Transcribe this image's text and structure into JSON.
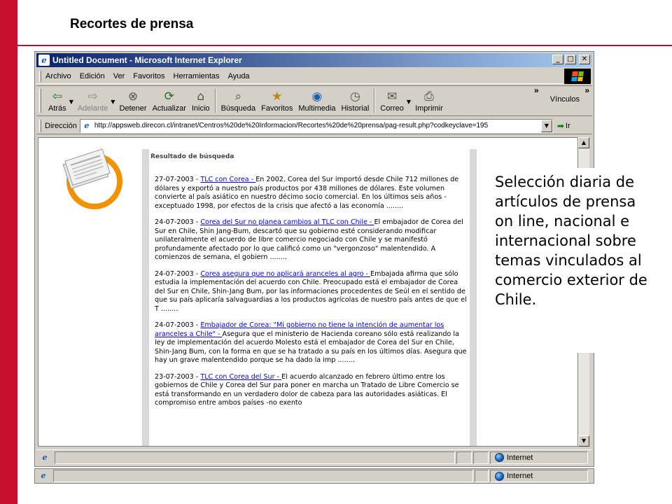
{
  "slide": {
    "title": "Recortes de prensa"
  },
  "window": {
    "title": "Untitled Document - Microsoft Internet Explorer",
    "controls": {
      "minimize": "_",
      "maximize": "□",
      "close": "✕"
    }
  },
  "menu": [
    "Archivo",
    "Edición",
    "Ver",
    "Favoritos",
    "Herramientas",
    "Ayuda"
  ],
  "toolbar": {
    "back": "Atrás",
    "forward": "Adelante",
    "stop": "Detener",
    "refresh": "Actualizar",
    "home": "Inicio",
    "search": "Búsqueda",
    "favorites": "Favoritos",
    "media": "Multimedia",
    "history": "Historial",
    "mail": "Correo",
    "print": "Imprimir",
    "links": "Vínculos"
  },
  "address": {
    "label": "Dirección",
    "url": "http://appsweb.direcon.cl/intranet/Centros%20de%20Informacion/Recortes%20de%20prensa/pag-result.php?codkeyclave=195",
    "go": "Ir"
  },
  "results": {
    "title": "Resultado de búsqueda",
    "items": [
      {
        "date": "27-07-2003 - ",
        "link": "TLC con Corea - ",
        "text": "En 2002, Corea del Sur importó desde Chile 712 millones de dólares y exportó a nuestro país productos por 438 millones de dólares. Este volumen convierte al país asiático en nuestro décimo socio comercial. En los últimos seis años - exceptuado 1998, por efectos de la crisis que afectó a las economía ........"
      },
      {
        "date": "24-07-2003 - ",
        "link": "Corea del Sur no planea cambios al TLC con Chile - ",
        "text": "El embajador de Corea del Sur en Chile, Shin Jang-Bum, descartó que su gobierno esté considerando modificar unilateralmente el acuerdo de libre comercio negociado con Chile y se manifestó profundamente afectado por lo que calificó como un \"vergonzoso\" malentendido. A comienzos de semana, el gobiern ........"
      },
      {
        "date": "24-07-2003 - ",
        "link": "Corea asegura que no aplicará aranceles al agro - ",
        "text": "Embajada afirma que sólo estudia la implementación del acuerdo con Chile. Preocupado está el embajador de Corea del Sur en Chile, Shin-Jang Bum, por las informaciones procedentes de Seúl en el sentido de que su país aplicaría salvaguardias a los productos agrícolas de nuestro país antes de que el T ........"
      },
      {
        "date": "24-07-2003 - ",
        "link": "Embajador de Corea: \"Mi gobierno no tiene la intención de aumentar los aranceles a Chile\" - ",
        "text": "Asegura que el ministerio de Hacienda coreano sólo está realizando la ley de implementación del acuerdo Molesto está el embajador de Corea del Sur en Chile, Shin-Jang Bum, con la forma en que se ha tratado a su país en los últimos días. Asegura que hay un grave malentendido porque se ha dado la imp ........"
      },
      {
        "date": "23-07-2003 - ",
        "link": "TLC con Corea del Sur - ",
        "text": "El acuerdo alcanzado en febrero último entre los gobiernos de Chile y Corea del Sur para poner en marcha un Tratado de Libre Comercio se está transformando en un verdadero dolor de cabeza para las autoridades asiáticas. El compromiso entre ambos países -no exento"
      }
    ]
  },
  "status": {
    "zone": "Internet"
  },
  "callout": "Selección diaria de artículos de prensa on line, nacional e internacional sobre temas vinculados al comercio exterior de Chile.",
  "colors": {
    "accent": "#c8102e",
    "ie_title_start": "#0a246a",
    "link": "#0000ee",
    "logo_orange": "#f39200"
  },
  "icons": [
    "back-arrow-icon",
    "forward-arrow-icon",
    "stop-icon",
    "refresh-icon",
    "home-icon",
    "search-icon",
    "favorites-icon",
    "media-icon",
    "history-icon",
    "mail-icon",
    "print-icon",
    "ie-page-icon",
    "go-arrow-icon",
    "globe-icon",
    "newspaper-logo-icon"
  ]
}
